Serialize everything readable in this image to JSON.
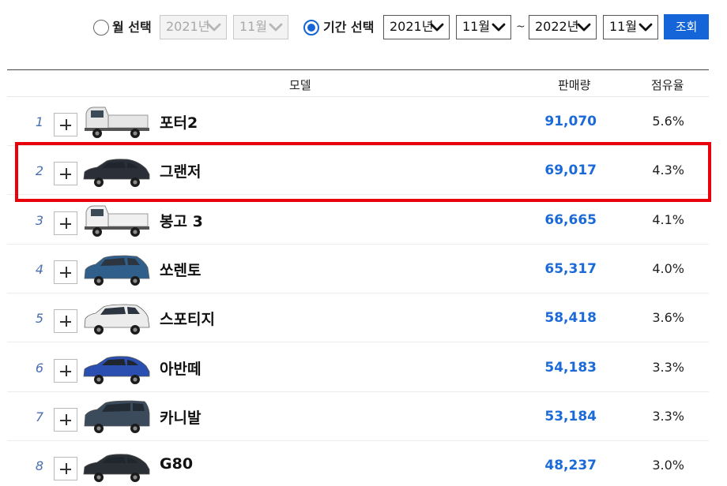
{
  "filter": {
    "month_select": {
      "label": "월 선택",
      "year": "2021년",
      "month": "11월",
      "checked": false
    },
    "period_select": {
      "label": "기간 선택",
      "checked": true,
      "from_year": "2021년",
      "from_month": "11월",
      "separator": "~",
      "to_year": "2022년",
      "to_month": "11월"
    },
    "search_button": "조회"
  },
  "table": {
    "headers": {
      "model": "모델",
      "sales": "판매량",
      "share": "점유율"
    },
    "rows": [
      {
        "rank": "1",
        "model": "포터2",
        "sales": "91,070",
        "share": "5.6%",
        "car_icon": "truck-icon"
      },
      {
        "rank": "2",
        "model": "그랜저",
        "sales": "69,017",
        "share": "4.3%",
        "car_icon": "sedan-icon"
      },
      {
        "rank": "3",
        "model": "봉고 3",
        "sales": "66,665",
        "share": "4.1%",
        "car_icon": "truck-icon"
      },
      {
        "rank": "4",
        "model": "쏘렌토",
        "sales": "65,317",
        "share": "4.0%",
        "car_icon": "suv-icon"
      },
      {
        "rank": "5",
        "model": "스포티지",
        "sales": "58,418",
        "share": "3.6%",
        "car_icon": "suv-icon"
      },
      {
        "rank": "6",
        "model": "아반떼",
        "sales": "54,183",
        "share": "3.3%",
        "car_icon": "sedan-icon"
      },
      {
        "rank": "7",
        "model": "카니발",
        "sales": "53,184",
        "share": "3.3%",
        "car_icon": "van-icon"
      },
      {
        "rank": "8",
        "model": "G80",
        "sales": "48,237",
        "share": "3.0%",
        "car_icon": "sedan-icon"
      }
    ],
    "highlighted_rank": "2"
  },
  "colors": {
    "accent": "#1565d8",
    "sales_text": "#1b6ad8",
    "highlight_border": "#e8000b",
    "car_bodies": [
      "#e6e6e6",
      "#2b3038",
      "#f0f0f0",
      "#2f5f8a",
      "#ececec",
      "#2a4fb0",
      "#3b4b5c",
      "#2a2f35"
    ]
  }
}
